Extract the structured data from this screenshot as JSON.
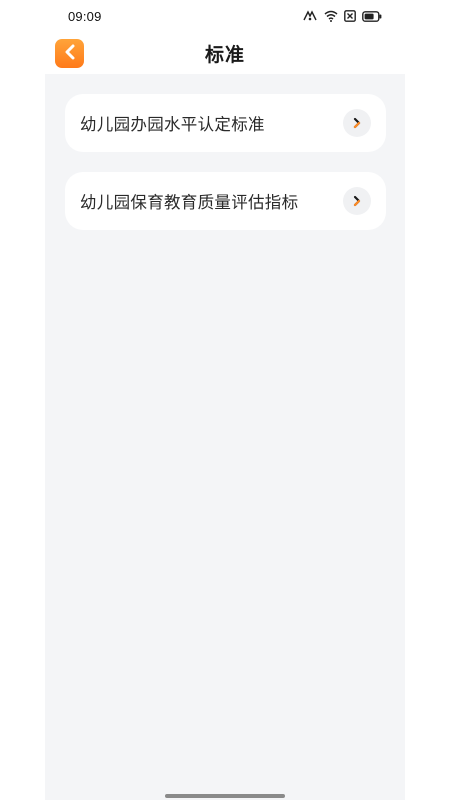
{
  "status_bar": {
    "time": "09:09",
    "icons": [
      "nfc-icon",
      "wifi-icon",
      "sim-off-icon",
      "battery-icon"
    ]
  },
  "nav": {
    "title": "标准",
    "back_icon": "chevron-left-icon"
  },
  "list": {
    "items": [
      {
        "label": "幼儿园办园水平认定标准",
        "icon": "chevron-right-icon"
      },
      {
        "label": "幼儿园保育教育质量评估指标",
        "icon": "chevron-right-icon"
      }
    ]
  },
  "colors": {
    "accent": "#ff8c26",
    "background": "#f4f5f7",
    "card": "#ffffff"
  }
}
